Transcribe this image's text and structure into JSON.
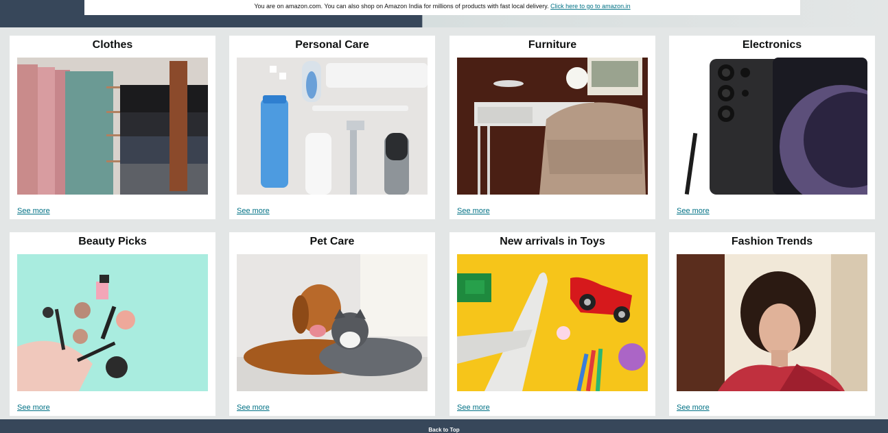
{
  "notice": {
    "text": "You are on amazon.com. You can also shop on Amazon India for millions of products with fast local delivery.",
    "link": "Click here to go to amazon.in"
  },
  "cards": [
    {
      "title": "Clothes",
      "link": "See more",
      "image_icon": "clothes-image"
    },
    {
      "title": "Personal Care",
      "link": "See more",
      "image_icon": "personal-care-image"
    },
    {
      "title": "Furniture",
      "link": "See more",
      "image_icon": "furniture-image"
    },
    {
      "title": "Electronics",
      "link": "See more",
      "image_icon": "electronics-image"
    },
    {
      "title": "Beauty Picks",
      "link": "See more",
      "image_icon": "beauty-image"
    },
    {
      "title": "Pet Care",
      "link": "See more",
      "image_icon": "pet-care-image"
    },
    {
      "title": "New arrivals in Toys",
      "link": "See more",
      "image_icon": "toys-image"
    },
    {
      "title": "Fashion Trends",
      "link": "See more",
      "image_icon": "fashion-image"
    }
  ],
  "footer": {
    "back_to_top": "Back to Top"
  },
  "colors": {
    "link": "#007185",
    "nav_dark": "#37475a",
    "page_bg": "#e3e6e6"
  }
}
